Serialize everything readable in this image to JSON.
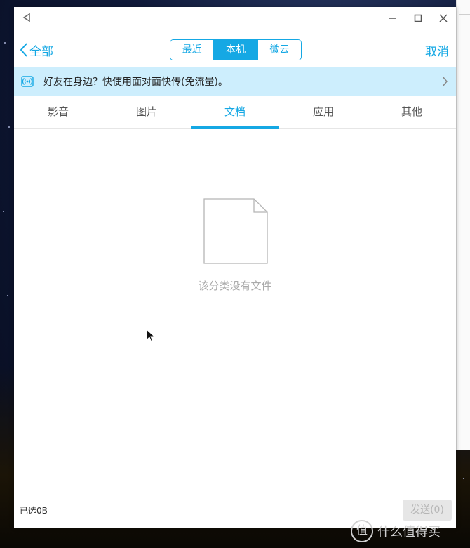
{
  "titlebar": {
    "back_icon": "back-triangle-icon",
    "min_icon": "minimize-icon",
    "max_icon": "maximize-icon",
    "close_icon": "close-icon"
  },
  "navbar": {
    "back_label": "全部",
    "segments": [
      {
        "label": "最近",
        "active": false
      },
      {
        "label": "本机",
        "active": true
      },
      {
        "label": "微云",
        "active": false
      }
    ],
    "cancel_label": "取消"
  },
  "banner": {
    "text": "好友在身边？快使用面对面快传(免流量)。"
  },
  "tabs": [
    {
      "label": "影音",
      "active": false
    },
    {
      "label": "图片",
      "active": false
    },
    {
      "label": "文档",
      "active": true
    },
    {
      "label": "应用",
      "active": false
    },
    {
      "label": "其他",
      "active": false
    }
  ],
  "empty": {
    "message": "该分类没有文件"
  },
  "footer": {
    "selected": "已选0B",
    "send_label": "发送(0)"
  },
  "watermark": {
    "text": "值 什么值得买"
  },
  "colors": {
    "accent": "#15a8e4",
    "banner_bg": "#cdeefd"
  }
}
